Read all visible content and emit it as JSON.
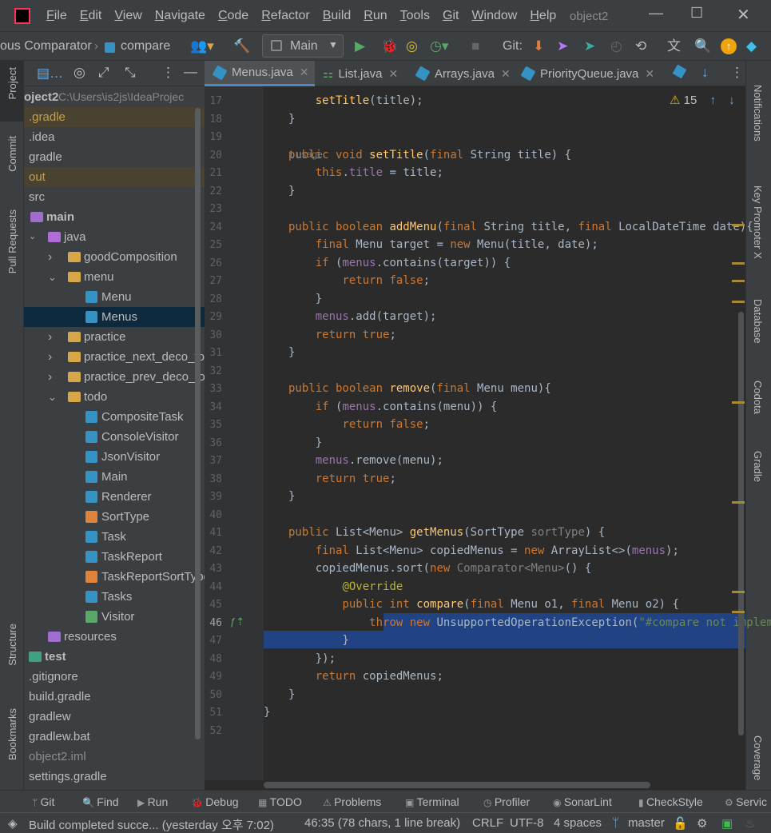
{
  "titlebar": {
    "app_icon": "intellij-logo-icon",
    "menu": [
      "File",
      "Edit",
      "View",
      "Navigate",
      "Code",
      "Refactor",
      "Build",
      "Run",
      "Tools",
      "Git",
      "Window",
      "Help"
    ],
    "project_name": "object2"
  },
  "toolbar": {
    "breadcrumb_1": "ous Comparator",
    "breadcrumb_2": "compare",
    "run_config": "Main",
    "git_label": "Git:"
  },
  "tabs": [
    {
      "label": "Menus.java",
      "active": true
    },
    {
      "label": "List.java"
    },
    {
      "label": "Arrays.java"
    },
    {
      "label": "PriorityQueue.java"
    }
  ],
  "left_strip": {
    "project": "Project",
    "commit": "Commit",
    "pull_requests": "Pull Requests",
    "structure": "Structure",
    "bookmarks": "Bookmarks"
  },
  "right_strip": {
    "notifications": "Notifications",
    "key_promoter": "Key Promoter X",
    "database": "Database",
    "codota": "Codota",
    "gradle": "Gradle",
    "coverage": "Coverage"
  },
  "project": {
    "root_name": "oject2",
    "root_path": "C:\\Users\\is2js\\IdeaProjec",
    "tree": [
      {
        "label": ".gradle",
        "indent": 0,
        "type": "excluded"
      },
      {
        "label": ".idea",
        "indent": 0,
        "type": "folder"
      },
      {
        "label": "gradle",
        "indent": 0,
        "type": "folder"
      },
      {
        "label": "out",
        "indent": 0,
        "type": "excluded"
      },
      {
        "label": "src",
        "indent": 0,
        "type": "folder"
      },
      {
        "label": "main",
        "indent": 1,
        "type": "module"
      },
      {
        "label": "java",
        "indent": 2,
        "type": "source"
      },
      {
        "label": "goodComposition",
        "indent": 3,
        "type": "package"
      },
      {
        "label": "menu",
        "indent": 3,
        "type": "package"
      },
      {
        "label": "Menu",
        "indent": 4,
        "type": "class"
      },
      {
        "label": "Menus",
        "indent": 4,
        "type": "class",
        "selected": true
      },
      {
        "label": "practice",
        "indent": 3,
        "type": "package"
      },
      {
        "label": "practice_next_deco_for",
        "indent": 3,
        "type": "package"
      },
      {
        "label": "practice_prev_deco_for",
        "indent": 3,
        "type": "package"
      },
      {
        "label": "todo",
        "indent": 3,
        "type": "package"
      },
      {
        "label": "CompositeTask",
        "indent": 4,
        "type": "class"
      },
      {
        "label": "ConsoleVisitor",
        "indent": 4,
        "type": "class"
      },
      {
        "label": "JsonVisitor",
        "indent": 4,
        "type": "class"
      },
      {
        "label": "Main",
        "indent": 4,
        "type": "class"
      },
      {
        "label": "Renderer",
        "indent": 4,
        "type": "class"
      },
      {
        "label": "SortType",
        "indent": 4,
        "type": "enum"
      },
      {
        "label": "Task",
        "indent": 4,
        "type": "class"
      },
      {
        "label": "TaskReport",
        "indent": 4,
        "type": "class"
      },
      {
        "label": "TaskReportSortType",
        "indent": 4,
        "type": "enum"
      },
      {
        "label": "Tasks",
        "indent": 4,
        "type": "class"
      },
      {
        "label": "Visitor",
        "indent": 4,
        "type": "interface"
      },
      {
        "label": "resources",
        "indent": 2,
        "type": "resources"
      },
      {
        "label": "test",
        "indent": 0,
        "type": "test"
      },
      {
        "label": ".gitignore",
        "indent": 0,
        "type": "file"
      },
      {
        "label": "build.gradle",
        "indent": 0,
        "type": "file"
      },
      {
        "label": "gradlew",
        "indent": 0,
        "type": "file"
      },
      {
        "label": "gradlew.bat",
        "indent": 0,
        "type": "file"
      },
      {
        "label": "object2.iml",
        "indent": 0,
        "type": "iml"
      },
      {
        "label": "settings.gradle",
        "indent": 0,
        "type": "file"
      }
    ]
  },
  "editor": {
    "warnings": "15",
    "current_line": "46",
    "usage_hint": "1 usage",
    "lines": [
      {
        "n": "17",
        "html": "    <span class='f'>setTitle</span>(title);"
      },
      {
        "n": "18",
        "html": "}"
      },
      {
        "n": "19",
        "html": ""
      },
      {
        "n": "20",
        "html": "<span class='k'>public void </span><span class='f'>setTitle</span>(<span class='k'>final </span>String title) {"
      },
      {
        "n": "21",
        "html": "    <span class='k'>this</span>.<span class='fd'>title</span> = title;"
      },
      {
        "n": "22",
        "html": "}"
      },
      {
        "n": "23",
        "html": ""
      },
      {
        "n": "24",
        "html": "<span class='k'>public boolean </span><span class='f'>addMenu</span>(<span class='k'>final </span>String title, <span class='k'>final </span>LocalDateTime date){"
      },
      {
        "n": "25",
        "html": "    <span class='k'>final </span>Menu target = <span class='k'>new </span>Menu(title, date);"
      },
      {
        "n": "26",
        "html": "    <span class='k'>if </span>(<span class='fd'>menus</span>.contains(target)) {"
      },
      {
        "n": "27",
        "html": "        <span class='k'>return false</span>;"
      },
      {
        "n": "28",
        "html": "    }"
      },
      {
        "n": "29",
        "html": "    <span class='fd'>menus</span>.add(target);"
      },
      {
        "n": "30",
        "html": "    <span class='k'>return true</span>;"
      },
      {
        "n": "31",
        "html": "}"
      },
      {
        "n": "32",
        "html": ""
      },
      {
        "n": "33",
        "html": "<span class='k'>public boolean </span><span class='f'>remove</span>(<span class='k'>final </span>Menu menu){"
      },
      {
        "n": "34",
        "html": "    <span class='k'>if </span>(<span class='fd'>menus</span>.contains(menu)) {"
      },
      {
        "n": "35",
        "html": "        <span class='k'>return false</span>;"
      },
      {
        "n": "36",
        "html": "    }"
      },
      {
        "n": "37",
        "html": "    <span class='fd'>menus</span>.remove(menu);"
      },
      {
        "n": "38",
        "html": "    <span class='k'>return true</span>;"
      },
      {
        "n": "39",
        "html": "}"
      },
      {
        "n": "40",
        "html": ""
      },
      {
        "n": "41",
        "html": "<span class='k'>public </span>List&lt;Menu&gt; <span class='f'>getMenus</span>(SortType <span class='g'>sortType</span>) {"
      },
      {
        "n": "42",
        "html": "    <span class='k'>final </span>List&lt;Menu&gt; copiedMenus = <span class='k'>new </span>ArrayList&lt;&gt;(<span class='fd'>menus</span>);"
      },
      {
        "n": "43",
        "html": "    copiedMenus.sort(<span class='k'>new </span><span class='g'>Comparator&lt;Menu&gt;</span>() {"
      },
      {
        "n": "44",
        "html": "        <span class='a'>@Override</span>"
      },
      {
        "n": "45",
        "html": "        <span class='k'>public int </span><span class='f'>compare</span>(<span class='k'>final </span>Menu o1, <span class='k'>final </span>Menu o2) {"
      },
      {
        "n": "46",
        "html": "            <span class='k'>throw new </span>UnsupportedOperationException(<span class='s'>\"#compare not implem</span>"
      },
      {
        "n": "47",
        "html": "        }"
      },
      {
        "n": "48",
        "html": "    });"
      },
      {
        "n": "49",
        "html": "    <span class='k'>return </span>copiedMenus;"
      },
      {
        "n": "50",
        "html": "}"
      },
      {
        "n": "51",
        "html": "}"
      },
      {
        "n": "52",
        "html": ""
      }
    ]
  },
  "bottom_tools": [
    "Git",
    "Find",
    "Run",
    "Debug",
    "TODO",
    "Problems",
    "Terminal",
    "Profiler",
    "SonarLint",
    "CheckStyle",
    "Servic"
  ],
  "status": {
    "message": "Build completed succe... (yesterday 오후 7:02)",
    "position": "46:35 (78 chars, 1 line break)",
    "line_sep": "CRLF",
    "encoding": "UTF-8",
    "indent": "4 spaces",
    "branch": "master"
  },
  "colors": {
    "accent": "#4a88c7",
    "selection": "#214283",
    "keyword": "#cc7832"
  }
}
